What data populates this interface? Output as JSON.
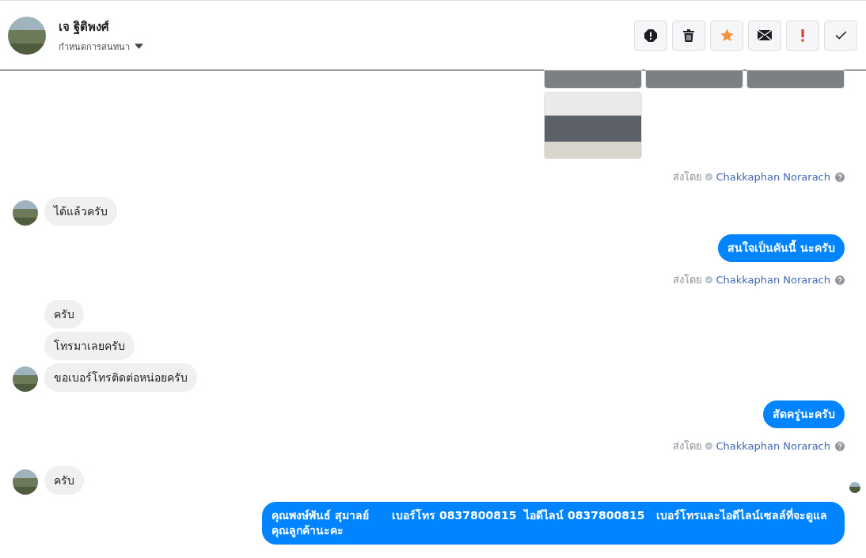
{
  "header": {
    "name": "เจ ฐิติพงศ์",
    "subtitle": "กำหนดการสนทนา",
    "actions": [
      {
        "kind": "report"
      },
      {
        "kind": "trash"
      },
      {
        "kind": "star"
      },
      {
        "kind": "mail"
      },
      {
        "kind": "important"
      },
      {
        "kind": "done"
      }
    ]
  },
  "messages": [
    {
      "kind": "photos",
      "photos": [
        {
          "cut_off": true
        },
        {
          "cut_off": true
        },
        {
          "cut_off": true
        },
        {
          "cut_off": false
        }
      ]
    },
    {
      "kind": "sent_by",
      "label": "ส่งโดย",
      "name": "Chakkaphan Norarach"
    },
    {
      "kind": "incoming",
      "lines": [
        "ได้แล้วครับ"
      ]
    },
    {
      "kind": "outgoing",
      "text": "สนใจเป็นคันนี้ นะครับ"
    },
    {
      "kind": "sent_by",
      "label": "ส่งโดย",
      "name": "Chakkaphan Norarach"
    },
    {
      "kind": "incoming",
      "lines": [
        "ครับ",
        "โทรมาเลยครับ",
        "ขอเบอร์โทรติดต่อหน่อยครับ"
      ]
    },
    {
      "kind": "outgoing",
      "text": "สัดครู่นะครับ"
    },
    {
      "kind": "sent_by",
      "label": "ส่งโดย",
      "name": "Chakkaphan Norarach"
    },
    {
      "kind": "incoming",
      "lines": [
        "ครับ"
      ]
    },
    {
      "kind": "seen"
    },
    {
      "kind": "outgoing",
      "text": "คุณพงษ์พันธ์ สุมาลย์      เบอร์โทร 0837800815  ไอดีไลน์ 0837800815   เบอร์โทรและไอดีไลน์เซลล์ที่จะดูแลคุณลูกค้านะคะ"
    }
  ]
}
